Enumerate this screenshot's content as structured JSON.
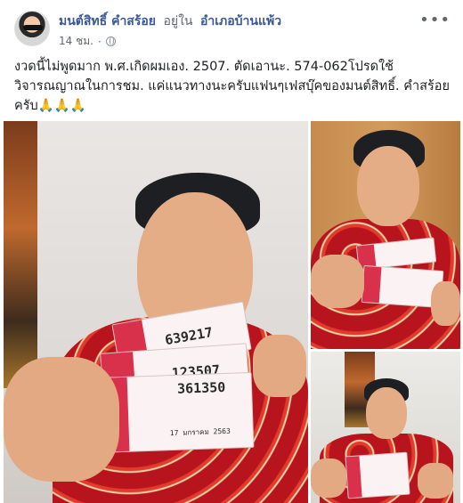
{
  "post": {
    "author": "มนต์สิทธิ์ คำสร้อย",
    "location_prefix": "อยู่ใน",
    "location": "อำเภอบ้านแพ้ว",
    "time": "14 ชม.",
    "more_icon": "•••",
    "text": "งวดนี้ไม่พูดมาก พ.ศ.เกิดผมเอง. 2507. ตัดเอานะ. 574-062โปรดใช้วิจารณญาณในการชม. แค่แนวทางนะครับแฟนๆเฟสบุ๊คของมนต์สิทธิ์. คำสร้อย ครับ🙏🙏🙏"
  },
  "photos": {
    "main": {
      "tickets": [
        "639217",
        "123507",
        "361350"
      ],
      "ticket_date": "17 มกราคม 2563"
    }
  },
  "colors": {
    "link": "#385898",
    "meta": "#616770",
    "lottery_pink": "#d9304c"
  }
}
